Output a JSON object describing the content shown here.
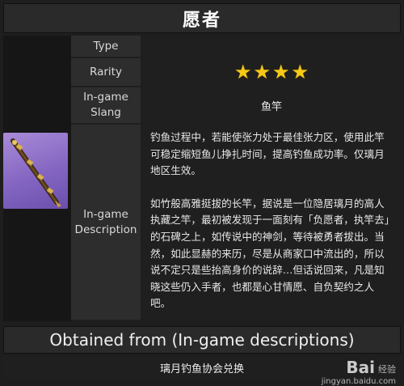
{
  "title": "愿者",
  "rows": {
    "type": {
      "label": "Type",
      "value": ""
    },
    "rarity": {
      "label": "Rarity",
      "stars": 4
    },
    "slang": {
      "label": "In-game Slang",
      "value": "鱼竿"
    },
    "description": {
      "label": "In-game Description",
      "paragraphs": [
        "钓鱼过程中，若能使张力处于最佳张力区，使用此竿可稳定缩短鱼儿挣扎时间，提高钓鱼成功率。仅璃月地区生效。",
        "如竹般高雅挺拔的长竿，据说是一位隐居璃月的高人执藏之竿，最初被发现于一面刻有「负愿者，执竿去」的石碑之上，如传说中的神剑，等待被勇者拔出。当然，如此显赫的来历，尽是从商家口中流出的，所以说不定只是些抬高身价的说辞…但话说回来，凡是知晓这些仍入手者，也都是心甘情愿、自负契约之人吧。"
      ]
    }
  },
  "obtained": {
    "heading": "Obtained from (In-game descriptions)",
    "source": "璃月钓鱼协会兑换"
  },
  "watermark": {
    "brand": "Bai",
    "brand_suffix": "经验",
    "url": "jingyan.baidu.com"
  },
  "colors": {
    "star": "#f6c915",
    "item_bg": "#8466c2"
  },
  "icons": {
    "star": "star-icon",
    "item": "fishing-rod-icon"
  }
}
